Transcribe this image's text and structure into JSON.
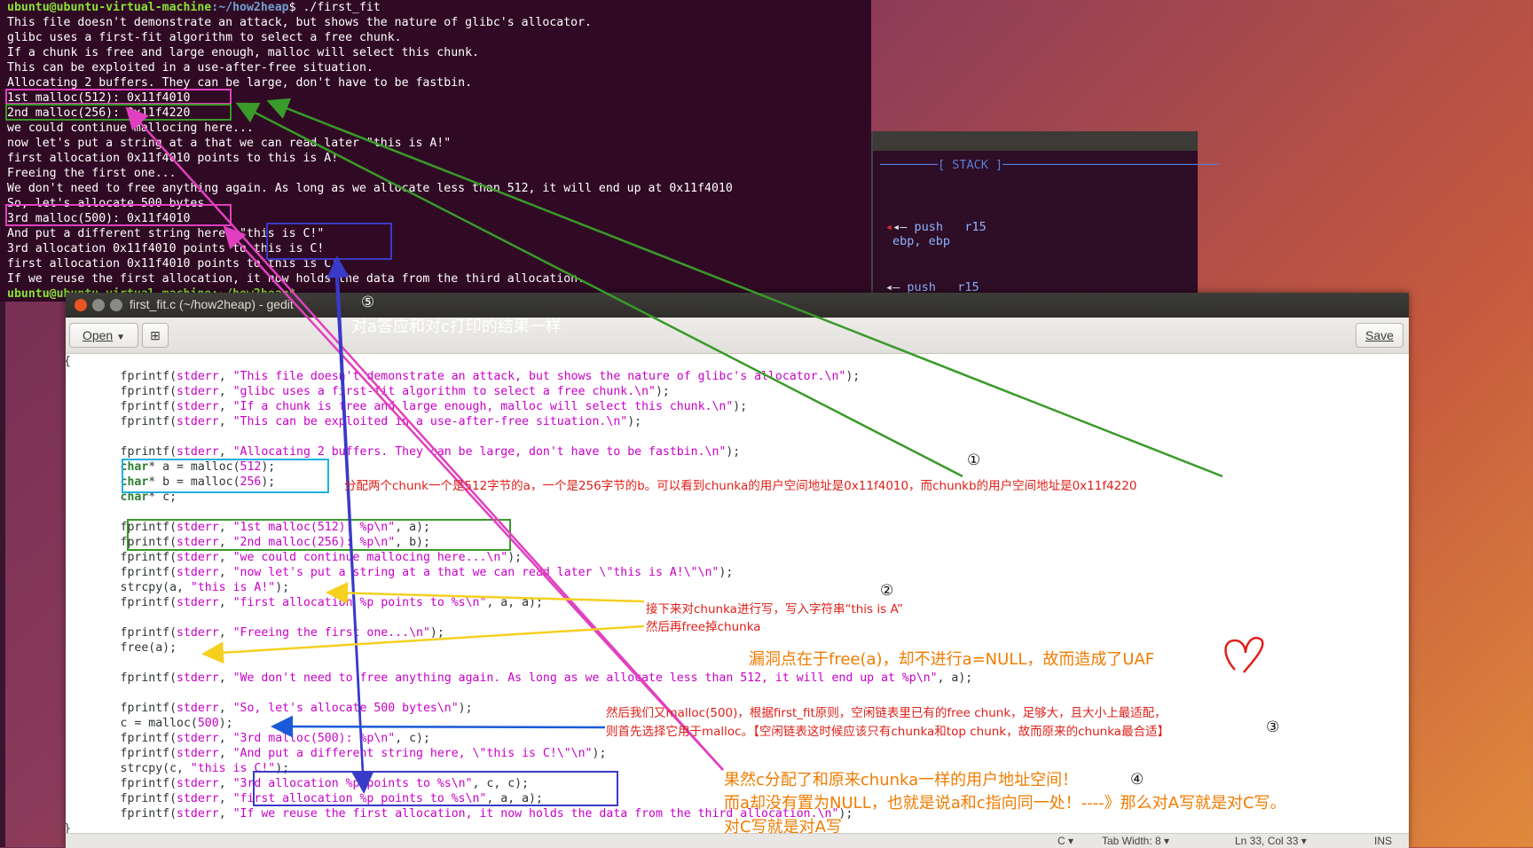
{
  "terminal": {
    "prompt_user": "ubuntu@ubuntu-virtual-machine",
    "prompt_path": ":~/how2heap",
    "command": "$ ./first_fit",
    "lines": [
      "This file doesn't demonstrate an attack, but shows the nature of glibc's allocator.",
      "glibc uses a first-fit algorithm to select a free chunk.",
      "If a chunk is free and large enough, malloc will select this chunk.",
      "This can be exploited in a use-after-free situation.",
      "Allocating 2 buffers. They can be large, don't have to be fastbin.",
      "1st malloc(512): 0x11f4010",
      "2nd malloc(256): 0x11f4220",
      "we could continue mallocing here...",
      "now let's put a string at a that we can read later \"this is A!\"",
      "first allocation 0x11f4010 points to this is A!",
      "Freeing the first one...",
      "We don't need to free anything again. As long as we allocate less than 512, it will end up at 0x11f4010",
      "So, let's allocate 500 bytes",
      "3rd malloc(500): 0x11f4010",
      "And put a different string here, \"this is C!\"",
      "3rd allocation 0x11f4010 points to this is C!",
      "first allocation 0x11f4010 points to this is C!",
      "If we reuse the first allocation, it now holds the data from the third allocation."
    ],
    "last_prompt": "ubuntu@ubuntu-virtual-machine:~/how2heap$ "
  },
  "gdb": {
    "stack_header": "────────[ STACK ]──────────────────────────────",
    "l1_arrow": "◂— ",
    "l1_cmd": "push   r15",
    "l2": "ebp, ebp",
    "l3_arrow": "◂— ",
    "l3_cmd": "push   r15"
  },
  "gedit": {
    "title": "first_fit.c (~/how2heap) - gedit",
    "open_label": "Open",
    "save_label": "Save",
    "status": {
      "lang": "C ▾",
      "tab": "Tab Width: 8 ▾",
      "pos": "Ln 33, Col 33 ▾",
      "ins": "INS"
    }
  },
  "annotations": {
    "a5_circle": "⑤",
    "a5_text": "对a答应和对c打印的结果一样",
    "a1_circle": "①",
    "a1_text": "分配两个chunk一个是512字节的a，一个是256字节的b。可以看到chunka的用户空间地址是0x11f4010，而chunkb的用户空间地址是0x11f4220",
    "a2_circle": "②",
    "a2_line1": "接下来对chunka进行写，写入字符串“this is A”",
    "a2_line2": "然后再free掉chunka",
    "uaf_text": "漏洞点在于free(a)，却不进行a=NULL，故而造成了UAF",
    "a3_line1": "然后我们又malloc(500)，根据first_fit原则，空闲链表里已有的free chunk，足够大，且大小上最适配，",
    "a3_line2": "则首先选择它用于malloc。【空闲链表这时候应该只有chunka和top chunk，故而原来的chunka最合适】",
    "a3_circle": "③",
    "a4_line1": "果然c分配了和原来chunka一样的用户地址空间！",
    "a4_circle": "④",
    "a4_line2": "而a却没有置为NULL，也就是说a和c指向同一处！----》那么对A写就是对C写。",
    "a4_line3": "对C写就是对A写"
  },
  "colors": {
    "terminal_bg": "#300a24",
    "pink": "#e040c0",
    "green": "#3a9a2a",
    "blue": "#3a3ac8",
    "cyan": "#20b0e0",
    "yellow": "#f5d020",
    "orange": "#f07c00",
    "red": "#e0201a"
  }
}
